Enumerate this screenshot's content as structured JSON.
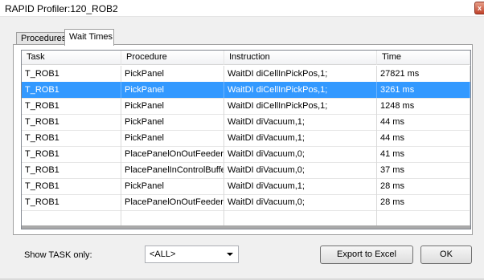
{
  "window": {
    "title": "RAPID Profiler:120_ROB2",
    "close_glyph": "x"
  },
  "tabs": [
    {
      "label": "Procedures",
      "active": false
    },
    {
      "label": "Wait Times",
      "active": true
    }
  ],
  "table": {
    "columns": [
      "Task",
      "Procedure",
      "Instruction",
      "Time"
    ],
    "rows": [
      [
        "T_ROB1",
        "PickPanel",
        "WaitDI diCellInPickPos,1;",
        "27821 ms"
      ],
      [
        "T_ROB1",
        "PickPanel",
        "WaitDI diCellInPickPos,1;",
        "3261 ms"
      ],
      [
        "T_ROB1",
        "PickPanel",
        "WaitDI diCellInPickPos,1;",
        "1248 ms"
      ],
      [
        "T_ROB1",
        "PickPanel",
        "WaitDI diVacuum,1;",
        "44 ms"
      ],
      [
        "T_ROB1",
        "PickPanel",
        "WaitDI diVacuum,1;",
        "44 ms"
      ],
      [
        "T_ROB1",
        "PlacePanelOnOutFeeder",
        "WaitDI diVacuum,0;",
        "41 ms"
      ],
      [
        "T_ROB1",
        "PlacePanelInControlBuffer",
        "WaitDI diVacuum,0;",
        "37 ms"
      ],
      [
        "T_ROB1",
        "PickPanel",
        "WaitDI diVacuum,1;",
        "28 ms"
      ],
      [
        "T_ROB1",
        "PlacePanelOnOutFeeder",
        "WaitDI diVacuum,0;",
        "28 ms"
      ],
      [
        "",
        "",
        "",
        ""
      ]
    ],
    "selected_row": 1
  },
  "footer": {
    "task_filter_label": "Show TASK only:",
    "task_filter_value": "<ALL>",
    "export_label": "Export to Excel",
    "ok_label": "OK"
  },
  "colors": {
    "selection": "#3399ff",
    "close_button": "#c0432b"
  }
}
